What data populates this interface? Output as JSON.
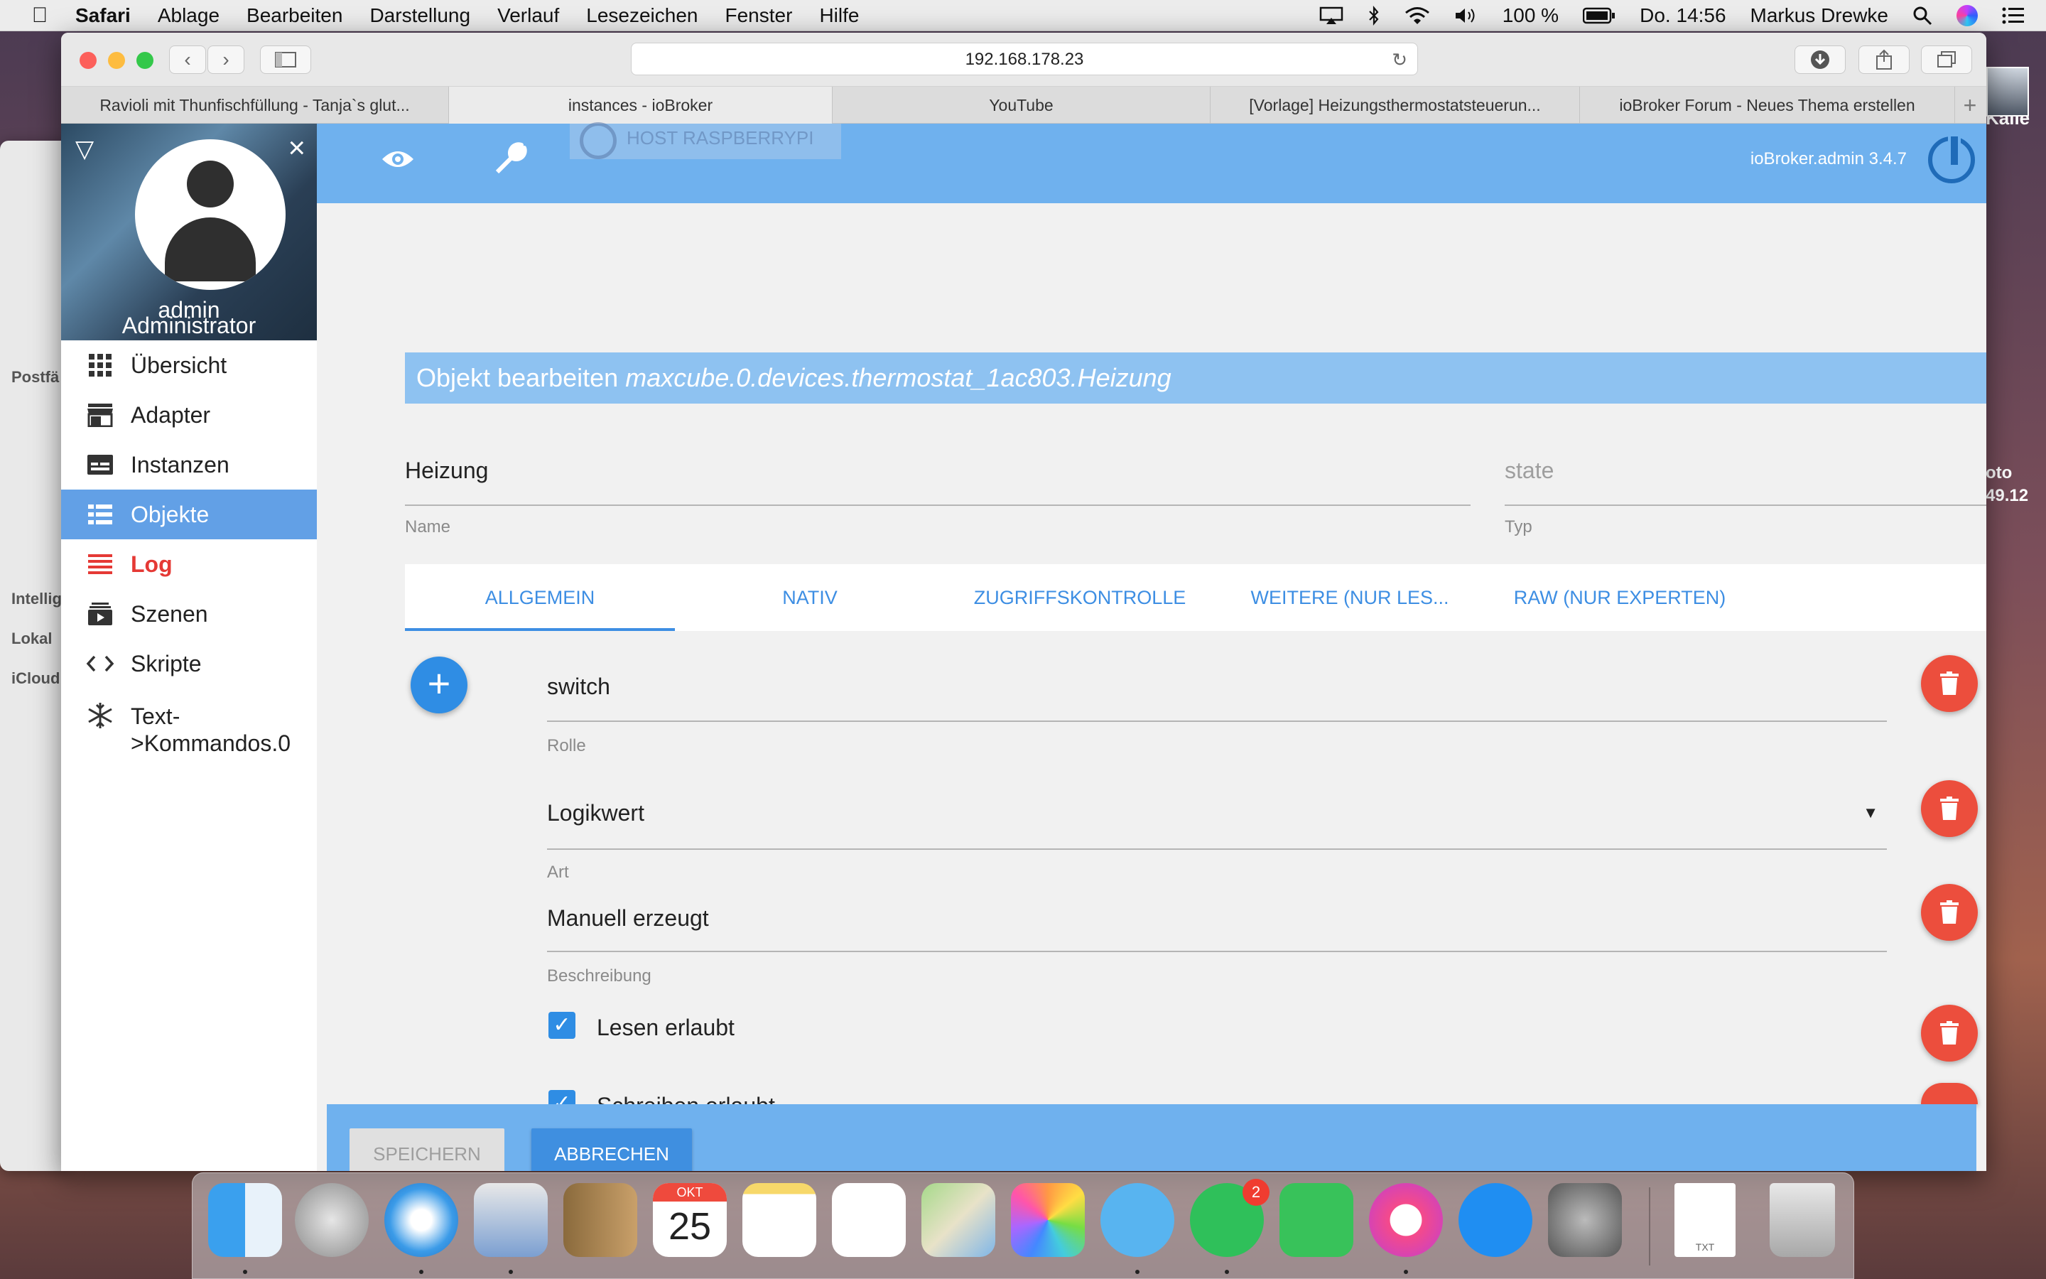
{
  "menubar": {
    "app": "Safari",
    "items": [
      "Ablage",
      "Bearbeiten",
      "Darstellung",
      "Verlauf",
      "Lesezeichen",
      "Fenster",
      "Hilfe"
    ],
    "battery": "100 %",
    "clock": "Do. 14:56",
    "user": "Markus Drewke"
  },
  "browser": {
    "url": "192.168.178.23",
    "tabs": [
      "Ravioli mit Thunfischfüllung - Tanja`s glut...",
      "instances - ioBroker",
      "YouTube",
      "[Vorlage] Heizungsthermostatsteuerun...",
      "ioBroker Forum - Neues Thema erstellen"
    ]
  },
  "background": {
    "sidebar_labels": [
      "Postfä",
      "Intellig",
      "Lokal",
      "iCloud"
    ],
    "desk_labels": [
      "d Kalle",
      "oto",
      "49.12"
    ]
  },
  "sidebar": {
    "user_name": "admin",
    "user_role": "Administrator",
    "items": [
      {
        "label": "Übersicht",
        "icon": "grid-icon"
      },
      {
        "label": "Adapter",
        "icon": "store-icon"
      },
      {
        "label": "Instanzen",
        "icon": "instances-icon"
      },
      {
        "label": "Objekte",
        "icon": "list-icon"
      },
      {
        "label": "Log",
        "icon": "log-icon"
      },
      {
        "label": "Szenen",
        "icon": "scenes-icon"
      },
      {
        "label": "Skripte",
        "icon": "code-icon"
      },
      {
        "label": "Text-\n>Kommandos.0",
        "icon": "snowflake-icon"
      }
    ]
  },
  "topbar": {
    "host_badge": "HOST RASPBERRYPI",
    "version": "ioBroker.admin 3.4.7"
  },
  "dialog": {
    "title_prefix": "Objekt bearbeiten",
    "object_id": "maxcube.0.devices.thermostat_1ac803.Heizung",
    "name_value": "Heizung",
    "name_label": "Name",
    "type_value": "state",
    "type_label": "Typ",
    "tabs": [
      "ALLGEMEIN",
      "NATIV",
      "ZUGRIFFSKONTROLLE",
      "WEITERE (NUR LES...",
      "RAW (NUR EXPERTEN)"
    ],
    "rolle_value": "switch",
    "rolle_label": "Rolle",
    "art_value": "Logikwert",
    "art_label": "Art",
    "beschreibung_value": "Manuell erzeugt",
    "beschreibung_label": "Beschreibung",
    "lesen_label": "Lesen erlaubt",
    "schreiben_label": "Schreiben erlaubt",
    "save_label": "SPEICHERN",
    "cancel_label": "ABBRECHEN"
  },
  "dock": {
    "whatsapp_badge": "2",
    "calendar_month": "OKT",
    "calendar_day": "25",
    "txt_label": "TXT"
  },
  "colors": {
    "accent_blue": "#6fb1ee",
    "primary_blue": "#2f8de4",
    "delete_red": "#ec4e3d",
    "log_red": "#e53935"
  }
}
